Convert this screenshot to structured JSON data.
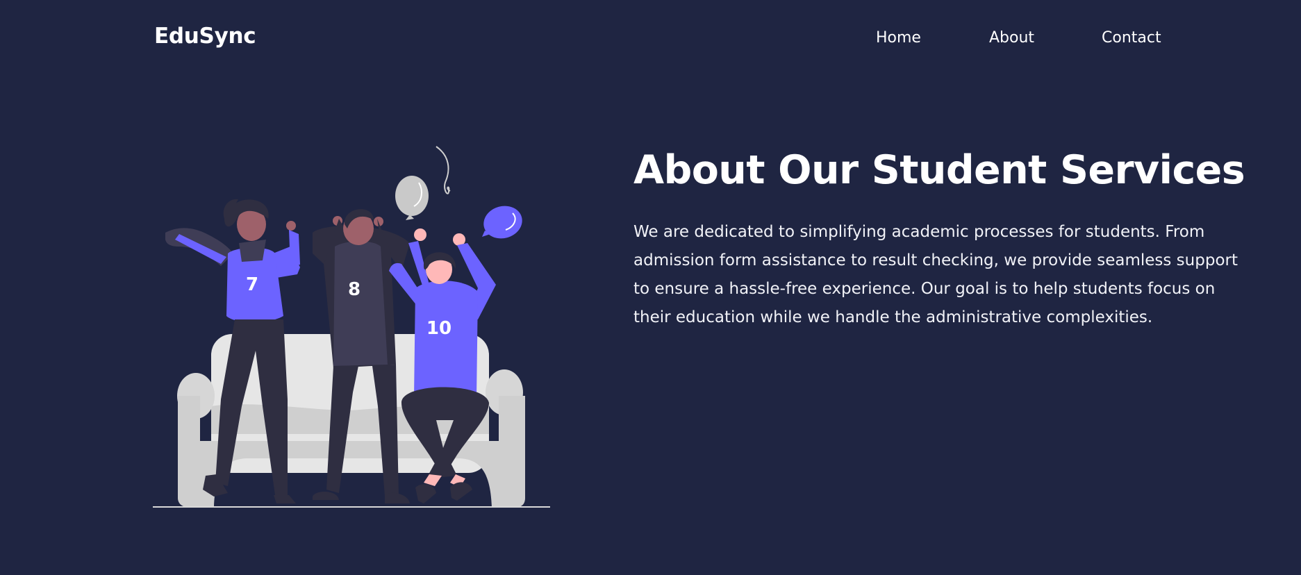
{
  "colors": {
    "background": "#1f2542",
    "accent": "#6c63ff",
    "text": "#ffffff",
    "dark_figure": "#2f2e41",
    "sofa": "#d9d9d9"
  },
  "header": {
    "brand": "EduSync",
    "nav": [
      {
        "label": "Home"
      },
      {
        "label": "About"
      },
      {
        "label": "Contact"
      }
    ]
  },
  "hero": {
    "title": "About Our Student Services",
    "description": "We are dedicated to simplifying academic processes for students. From admission form assistance to result checking, we provide seamless support to ensure a hassle-free experience. Our goal is to help students focus on their education while we handle the administrative complexities.",
    "illustration": {
      "jersey_numbers": [
        "7",
        "8",
        "10"
      ]
    }
  }
}
